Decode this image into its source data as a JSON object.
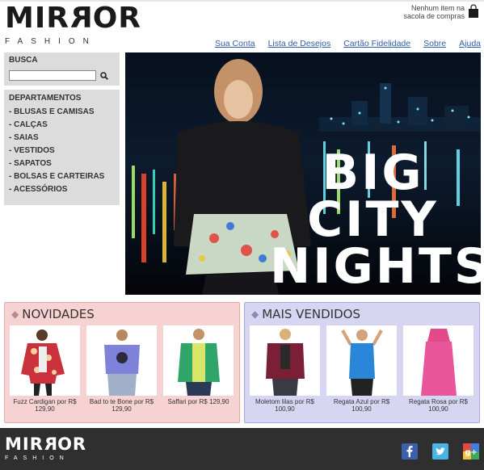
{
  "header": {
    "logo_main_pre": "MIR",
    "logo_main_flip": "R",
    "logo_main_post": "OR",
    "logo_sub": "FASHION",
    "cart_text": "Nenhum item na sacola de compras",
    "nav_links": [
      "Sua Conta",
      "Lista de Desejos",
      "Cartão Fidelidade",
      "Sobre",
      "Ajuda"
    ]
  },
  "sidebar": {
    "search_title": "BUSCA",
    "search_value": "",
    "departments_title": "DEPARTAMENTOS",
    "departments": [
      "BLUSAS E CAMISAS",
      "CALÇAS",
      "SAIAS",
      "VESTIDOS",
      "SAPATOS",
      "BOLSAS E CARTEIRAS",
      "ACESSÓRIOS"
    ]
  },
  "banner": {
    "lines": [
      "BIG",
      "CITY",
      "NIGHTS"
    ]
  },
  "novidades": {
    "title": "NOVIDADES",
    "products": [
      {
        "caption": "Fuzz Cardigan por R$ 129,90"
      },
      {
        "caption": "Bad to te Bone por R$ 129,90"
      },
      {
        "caption": "Saffari por R$ 129,90"
      }
    ]
  },
  "mais_vendidos": {
    "title": "MAIS VENDIDOS",
    "products": [
      {
        "caption": "Moletom lilas por R$ 100,90"
      },
      {
        "caption": "Regata Azul por R$ 100,90"
      },
      {
        "caption": "Regata Rosa por R$ 100,90"
      }
    ]
  },
  "footer": {
    "logo_main_pre": "MIR",
    "logo_main_flip": "R",
    "logo_main_post": "OR",
    "logo_sub": "FASHION",
    "social": [
      "facebook-icon",
      "twitter-icon",
      "google-plus-icon"
    ]
  },
  "colors": {
    "link": "#2e5da8",
    "novidades_bg": "#f6d2d2",
    "mais_vendidos_bg": "#d6d6f3",
    "footer_bg": "#2f2f2f"
  }
}
